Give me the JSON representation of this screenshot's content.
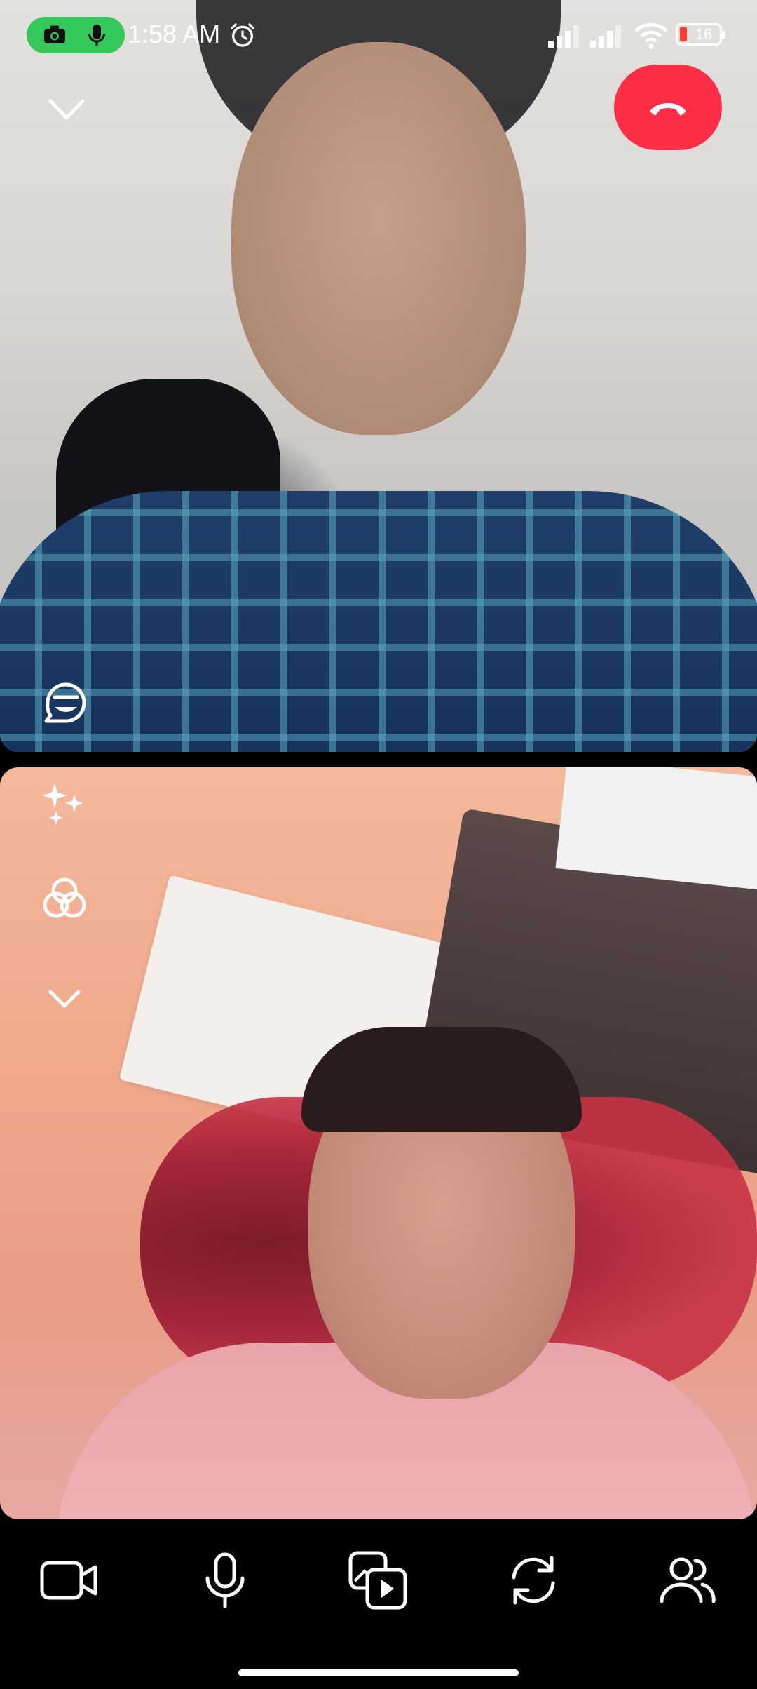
{
  "status_bar": {
    "time": "1:58 AM",
    "battery_level": "16",
    "privacy_indicator_icons": [
      "camera-icon",
      "microphone-icon"
    ],
    "icons": [
      "alarm-icon",
      "signal-icon",
      "signal-icon",
      "wifi-icon",
      "battery-icon"
    ]
  },
  "call": {
    "controls_top": [
      "chevron-down-icon",
      "end-call-icon"
    ],
    "controls_side": [
      "caption-icon",
      "sparkle-effects-icon",
      "filters-icon",
      "chevron-down-icon"
    ],
    "bottom_bar": [
      "video-camera-icon",
      "microphone-icon",
      "share-media-icon",
      "flip-camera-icon",
      "participants-icon"
    ]
  },
  "colors": {
    "end_call": "#ff2d46",
    "privacy_pill": "#34c759",
    "battery_low": "#ff3b30",
    "background": "#000000"
  }
}
